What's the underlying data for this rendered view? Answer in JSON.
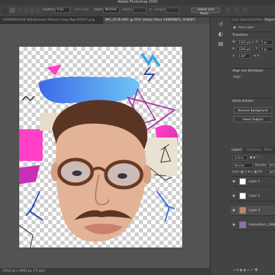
{
  "app": {
    "title": "Adobe Photoshop 2020"
  },
  "options_bar": {
    "feather_label": "Feather:",
    "feather_value": "0 px",
    "antialias_label": "Anti-alias",
    "style_label": "Style:",
    "style_value": "Normal",
    "width_label": "Width:",
    "height_label": "Height:",
    "select_mask_label": "Select and Mask..."
  },
  "doc_tabs": [
    {
      "label": "129980932426 600x6xmesh Patreon Coop Map KI5017.png",
      "active": false
    },
    {
      "label": "IMG_6578.HEIC @ 25% (Adobe Stock 198896851, RGB/8*)",
      "active": true
    }
  ],
  "status": {
    "text": "2912 px x 2662 px (72 ppi)"
  },
  "panels": {
    "properties": {
      "tabs": [
        "Colo",
        "Swat",
        "Grad",
        "Patt",
        "Properties"
      ],
      "layer_kind": "Pixel Layer",
      "transform_label": "Transform",
      "w_value": "2345 px",
      "h_value": "3246 px",
      "x_value": "0 px",
      "y_value": "0 px",
      "angle_value": "0.00°",
      "align_label": "Align and Distribute",
      "align_sub": "Align:",
      "quick_actions_label": "Quick Actions",
      "remove_bg_label": "Remove Background",
      "select_subject_label": "Select Subject"
    },
    "layers": {
      "tabs": [
        "Layers",
        "Channels",
        "Paths"
      ],
      "kind_label": "Q Kind",
      "blend_mode": "Normal",
      "opacity_label": "Opacity:",
      "opacity_value": "100%",
      "lock_label": "Lock:",
      "fill_label": "Fill:",
      "fill_value": "100%",
      "items": [
        {
          "name": "Layer 1",
          "selected": false
        },
        {
          "name": "Layer 2",
          "selected": false
        },
        {
          "name": "Layer 3",
          "selected": true
        },
        {
          "name": "AdobeStock_198896...",
          "selected": false
        }
      ]
    }
  }
}
